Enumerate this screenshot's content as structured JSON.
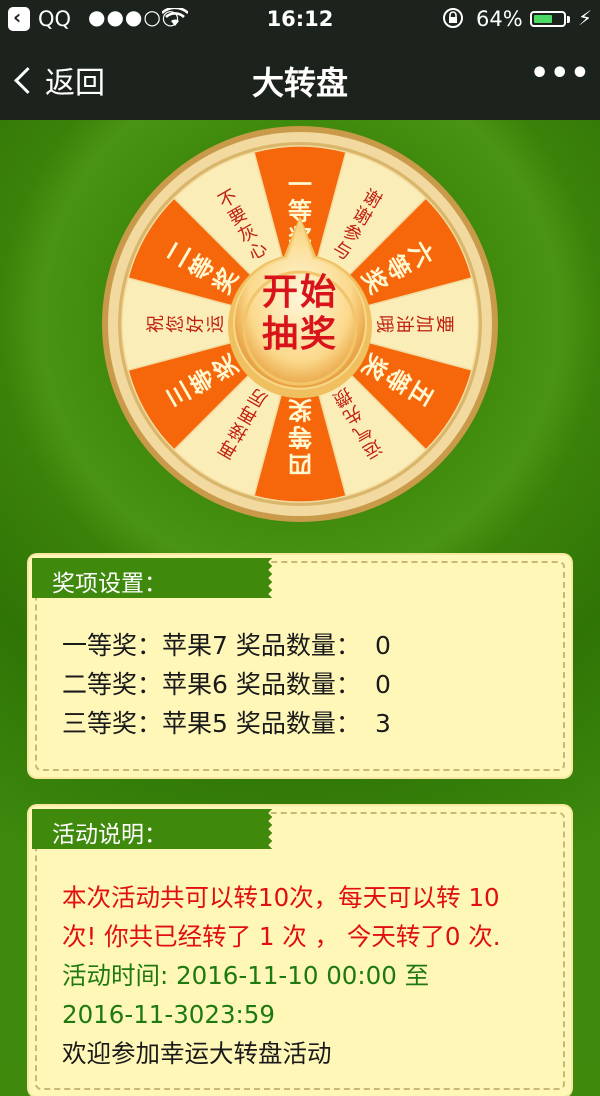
{
  "status_bar": {
    "back_app": "QQ",
    "signal": "●●●○○",
    "time": "16:12",
    "battery_percent": "64%",
    "battery_level": 0.64
  },
  "nav": {
    "back_label": "返回",
    "title": "大转盘",
    "more_label": "•••"
  },
  "wheel": {
    "segments": [
      {
        "label": "一等奖",
        "color": "#f5670a"
      },
      {
        "label": "谢谢参与",
        "color": "#fbedb8"
      },
      {
        "label": "六等奖",
        "color": "#f5670a"
      },
      {
        "label": "要加油哦",
        "color": "#fbedb8"
      },
      {
        "label": "五等奖",
        "color": "#f5670a"
      },
      {
        "label": "运气先攒着",
        "color": "#fbedb8"
      },
      {
        "label": "四等奖",
        "color": "#f5670a"
      },
      {
        "label": "再接再厉",
        "color": "#fbedb8"
      },
      {
        "label": "三等奖",
        "color": "#f5670a"
      },
      {
        "label": "祝您好运",
        "color": "#fbedb8"
      },
      {
        "label": "二等奖",
        "color": "#f5670a"
      },
      {
        "label": "不要灰心",
        "color": "#fbedb8"
      }
    ],
    "start_label_line1": "开始",
    "start_label_line2": "抽奖"
  },
  "prizes_panel": {
    "title": "奖项设置：",
    "items": [
      {
        "rank": "一等奖：",
        "name": "苹果7",
        "qty_label": "奖品数量：",
        "qty": "0"
      },
      {
        "rank": "二等奖：",
        "name": "苹果6",
        "qty_label": "奖品数量：",
        "qty": "0"
      },
      {
        "rank": "三等奖：",
        "name": "苹果5",
        "qty_label": "奖品数量：",
        "qty": "3"
      }
    ]
  },
  "info_panel": {
    "title": "活动说明：",
    "line1": "本次活动共可以转10次，每天可以转 10",
    "line2": "次! 你共已经转了 1 次 ， 今天转了0 次.",
    "line3": "活动时间: 2016-11-10 00:00 至",
    "line4": "2016-11-3023:59",
    "line5": "欢迎参加幸运大转盘活动"
  }
}
